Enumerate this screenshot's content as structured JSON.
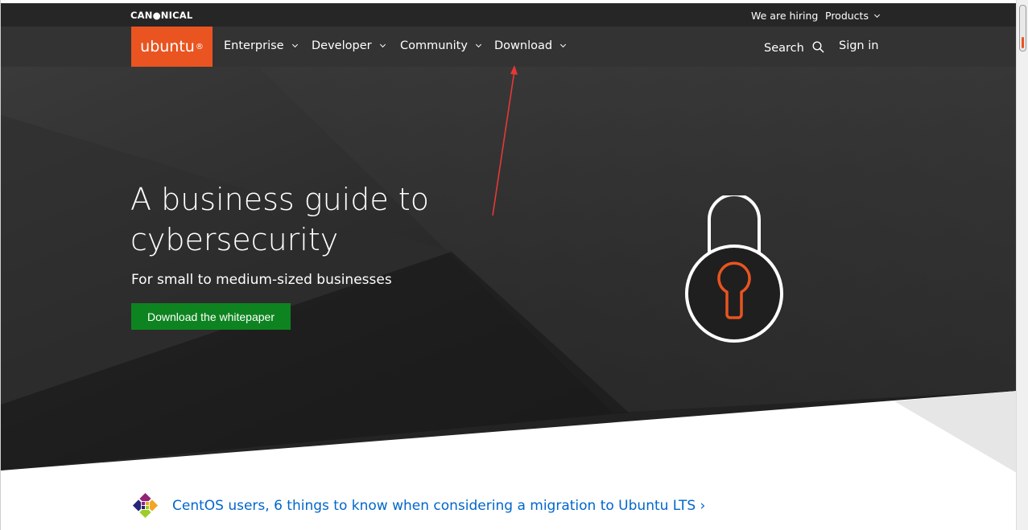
{
  "global_bar": {
    "brand": "CAN●NICAL",
    "links": [
      "We are hiring",
      "Products"
    ]
  },
  "nav": {
    "logo_text": "ubuntu",
    "logo_mark": "®",
    "items": [
      "Enterprise",
      "Developer",
      "Community",
      "Download"
    ],
    "search_label": "Search",
    "signin_label": "Sign in"
  },
  "hero": {
    "title": "A business guide to cybersecurity",
    "subtitle": "For small to medium-sized businesses",
    "cta_label": "Download the whitepaper",
    "illustration": "padlock-icon"
  },
  "promo": {
    "icon": "centos-logo-icon",
    "text": "CentOS users, 6 things to know when considering a migration to Ubuntu LTS ›"
  },
  "colors": {
    "brand_orange": "#e95420",
    "cta_green": "#0e8420",
    "link_blue": "#0066cc",
    "nav_bg": "#333333",
    "global_bar_bg": "#262626"
  }
}
